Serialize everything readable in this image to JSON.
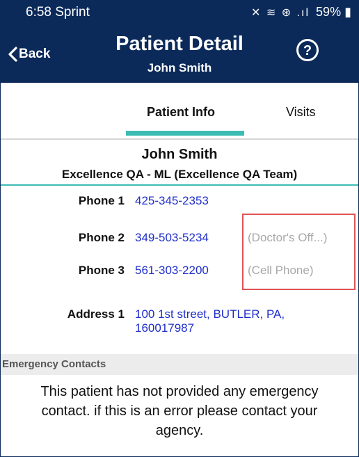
{
  "status_bar": {
    "time_carrier": "6:58 Sprint",
    "signal_icons": "✕ ≋ ⊛ .ıl",
    "battery": "59%"
  },
  "header": {
    "back_label": "Back",
    "title": "Patient Detail",
    "subtitle": "John Smith",
    "help_icon": "help-circle-icon"
  },
  "tabs": [
    {
      "label": "Patient Info",
      "active": true
    },
    {
      "label": "Visits",
      "active": false
    }
  ],
  "accent_color": "#3cbcb3",
  "link_color": "#1f2ec9",
  "patient": {
    "name": "John  Smith",
    "agency": "Excellence QA - ML (Excellence QA Team)",
    "phones": [
      {
        "label": "Phone 1",
        "value": "425-345-2353",
        "note": ""
      },
      {
        "label": "Phone 2",
        "value": "349-503-5234",
        "note": "(Doctor's Off...)"
      },
      {
        "label": "Phone 3",
        "value": "561-303-2200",
        "note": "(Cell Phone)"
      }
    ],
    "address": {
      "label": "Address 1",
      "value": "100 1st street, BUTLER, PA, 160017987"
    }
  },
  "emergency": {
    "heading": "Emergency Contacts",
    "message": "This patient has not provided any emergency contact. if this is an error please contact your agency."
  }
}
